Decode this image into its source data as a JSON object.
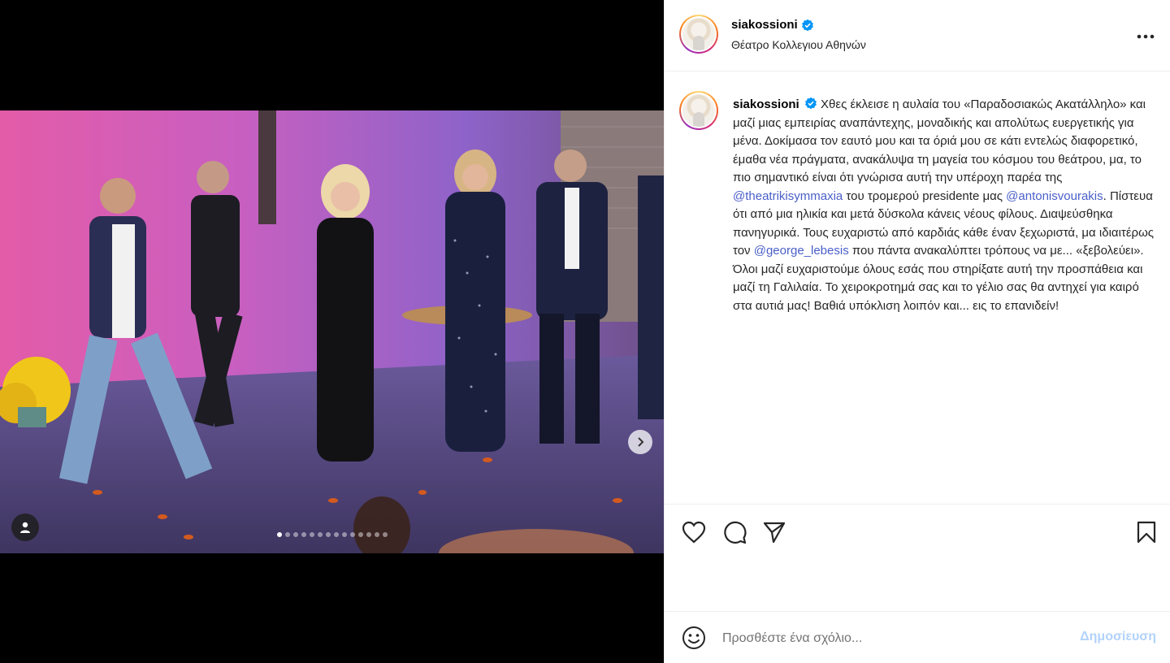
{
  "post": {
    "username": "siakossioni",
    "location": "Θέατρο Κολλεγιου Αθηνών",
    "more_icon": "more-options-icon",
    "carousel": {
      "total_slides": 14,
      "active_slide": 1
    }
  },
  "caption": {
    "username": "siakossioni",
    "seg1": " Χθες έκλεισε η αυλαία του «Παραδοσιακώς Ακατάλληλο» και μαζί μιας εμπειρίας αναπάντεχης, μοναδικής και απολύτως ευεργετικής για μένα. Δοκίμασα τον εαυτό μου και τα όριά μου σε κάτι εντελώς διαφορετικό, έμαθα νέα πράγματα, ανακάλυψα τη μαγεία του κόσμου του θεάτρου, μα, το πιο σημαντικό είναι ότι γνώρισα αυτή την υπέροχη παρέα της ",
    "mention1": "@theatrikisymmaxia",
    "seg2": " του τρομερού presidente μας ",
    "mention2": "@antonisvourakis",
    "seg3": ". Πίστευα ότι από μια ηλικία και μετά δύσκολα κάνεις νέους φίλους. Διαψεύσθηκα πανηγυρικά. Τους ευχαριστώ από καρδιάς κάθε έναν ξεχωριστά, μα ιδιαιτέρως τον ",
    "mention3": "@george_lebesis",
    "seg4": " που πάντα ανακαλύπτει τρόπους να με... «ξεβολεύει». Όλοι μαζί ευχαριστούμε όλους εσάς που στηρίξατε αυτή την προσπάθεια και μαζί τη Γαλιλαία. Το χειροκροτημά σας και το γέλιο σας θα αντηχεί για καιρό στα αυτιά μας! Βαθιά υπόκλιση λοιπόν και... εις το επανιδείν!"
  },
  "comment": {
    "placeholder": "Προσθέστε ένα σχόλιο...",
    "post_label": "Δημοσίευση"
  },
  "colors": {
    "verified": "#0095f6",
    "mention": "#4a5fc9",
    "post_disabled": "#b2d2fa"
  }
}
